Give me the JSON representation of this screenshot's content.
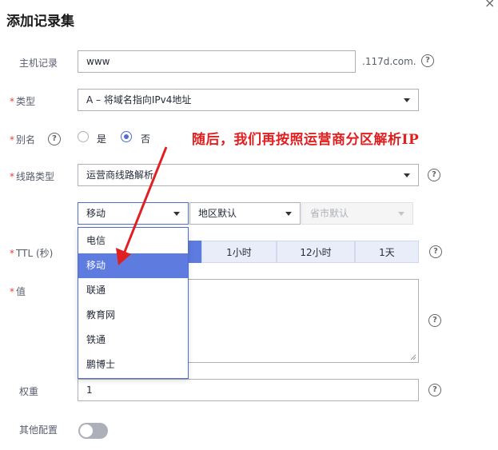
{
  "dialog": {
    "title": "添加记录集",
    "close_glyph": "×"
  },
  "host": {
    "label": "主机记录",
    "value": "www",
    "suffix": ".117d.com.",
    "help_glyph": "?"
  },
  "type": {
    "required_mark": "*",
    "label": "类型",
    "value": "A – 将域名指向IPv4地址"
  },
  "alias": {
    "required_mark": "*",
    "label": "别名",
    "option_yes": "是",
    "option_no": "否",
    "selected": "否"
  },
  "line_type": {
    "required_mark": "*",
    "label": "线路类型",
    "value": "运营商线路解析"
  },
  "line": {
    "isp_value": "移动",
    "region_value": "地区默认",
    "province_value": "省市默认",
    "options": [
      "电信",
      "移动",
      "联通",
      "教育网",
      "铁通",
      "鹏博士"
    ],
    "selected_option": "移动"
  },
  "ttl": {
    "required_mark": "*",
    "label": "TTL (秒)",
    "options": [
      "1小时",
      "12小时",
      "1天"
    ]
  },
  "value_field": {
    "required_mark": "*",
    "label": "值"
  },
  "weight": {
    "label": "权重",
    "value": "1"
  },
  "other_config": {
    "label": "其他配置",
    "enabled": false
  },
  "annotation": {
    "text": "随后，我们再按照运营商分区解析IP",
    "color": "#e02020"
  },
  "colors": {
    "accent": "#5e7ce0",
    "required": "#e8413d",
    "annotation": "#e02020"
  }
}
